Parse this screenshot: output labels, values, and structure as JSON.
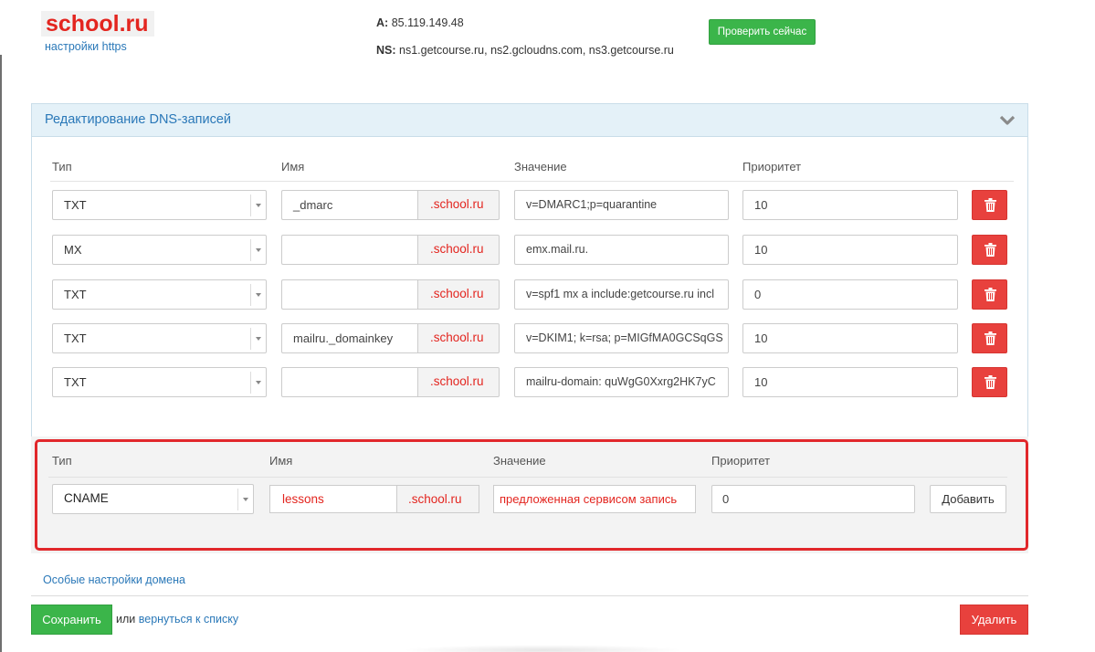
{
  "header": {
    "domain": "school.ru",
    "https_link": "настройки https",
    "a_label": "A:",
    "a_value": "85.119.149.48",
    "ns_label": "NS:",
    "ns_value": "ns1.getcourse.ru, ns2.gcloudns.com, ns3.getcourse.ru",
    "check_button": "Проверить сейчас"
  },
  "panel": {
    "title": "Редактирование DNS-записей",
    "columns": [
      "Тип",
      "Имя",
      "Значение",
      "Приоритет"
    ],
    "suffix": ".school.ru",
    "records": [
      {
        "type": "TXT",
        "name": "_dmarc",
        "value": "v=DMARC1;p=quarantine",
        "priority": "10"
      },
      {
        "type": "MX",
        "name": "",
        "value": "emx.mail.ru.",
        "priority": "10"
      },
      {
        "type": "TXT",
        "name": "",
        "value": "v=spf1 mx a include:getcourse.ru incl",
        "priority": "0"
      },
      {
        "type": "TXT",
        "name": "mailru._domainkey",
        "value": "v=DKIM1; k=rsa; p=MIGfMA0GCSqGS",
        "priority": "10"
      },
      {
        "type": "TXT",
        "name": "",
        "value": "mailru-domain: quWgG0Xxrg2HK7yC",
        "priority": "10"
      }
    ]
  },
  "add_record": {
    "columns": [
      "Тип",
      "Имя",
      "Значение",
      "Приоритет"
    ],
    "type": "CNAME",
    "name": "lessons",
    "suffix": ".school.ru",
    "value": "предложенная сервисом запись",
    "priority": "0",
    "add_button": "Добавить"
  },
  "footer": {
    "special_settings_link": "Особые настройки домена",
    "save_button": "Сохранить",
    "or_text": "или",
    "back_link": "вернуться к списку",
    "delete_button": "Удалить"
  },
  "colors": {
    "accent_red": "#e3251f",
    "success_green": "#3bb54a",
    "danger_red": "#e8413d",
    "link_blue": "#2a78b8"
  }
}
